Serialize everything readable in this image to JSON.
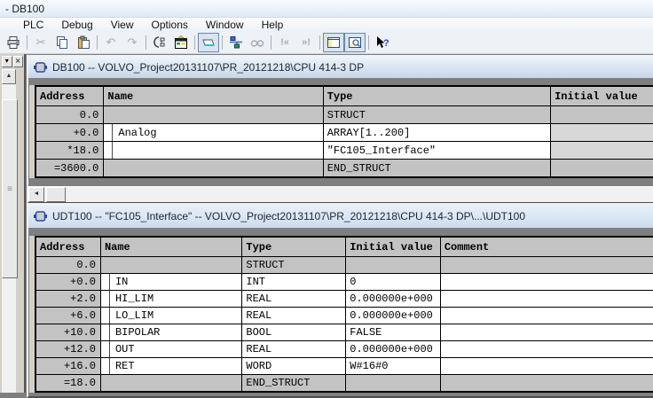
{
  "window": {
    "title": "- DB100"
  },
  "menu": {
    "items": [
      "PLC",
      "Debug",
      "View",
      "Options",
      "Window",
      "Help"
    ]
  },
  "toolbar": {
    "buttons": [
      "print",
      "cut",
      "copy",
      "paste",
      "undo",
      "redo",
      "download",
      "monitor-table",
      "symbol-display-toggle",
      "network",
      "glasses",
      "jump-prev",
      "jump-next",
      "window-declaration-view",
      "window-data-view",
      "help-select"
    ],
    "disabled": [
      "cut",
      "undo",
      "redo",
      "glasses",
      "jump-prev",
      "jump-next"
    ],
    "pressed": [
      "symbol-display-toggle",
      "window-declaration-view",
      "window-data-view"
    ],
    "glyphs": {
      "cut": "✂",
      "undo": "↶",
      "redo": "↷",
      "jump_prev": "!«",
      "jump_next": "»!"
    }
  },
  "left_pane": {
    "menu_button": "▾",
    "close_button": "×",
    "scroll_up": "▲",
    "thumb_grip": "≡"
  },
  "db_window": {
    "title": "DB100 -- VOLVO_Project20131107\\PR_20121218\\CPU 414-3 DP",
    "columns": [
      "Address",
      "Name",
      "Type",
      "Initial value"
    ],
    "col_keys": [
      "address",
      "name",
      "type",
      "initial"
    ],
    "rows": [
      {
        "address": "0.0",
        "name": "",
        "type": "STRUCT",
        "initial": "",
        "kind": "struct"
      },
      {
        "address": "+0.0",
        "name": "Analog",
        "type": "ARRAY[1..200]",
        "initial": "",
        "kind": "data"
      },
      {
        "address": "*18.0",
        "name": "",
        "type": "\"FC105_Interface\"",
        "initial": "",
        "kind": "data"
      },
      {
        "address": "=3600.0",
        "name": "",
        "type": "END_STRUCT",
        "initial": "",
        "kind": "struct"
      }
    ],
    "hscroll_left_arrow": "◄"
  },
  "udt_window": {
    "title": "UDT100 -- \"FC105_Interface\" -- VOLVO_Project20131107\\PR_20121218\\CPU 414-3 DP\\...\\UDT100",
    "columns": [
      "Address",
      "Name",
      "Type",
      "Initial value",
      "Comment"
    ],
    "col_keys": [
      "address",
      "name",
      "type",
      "initial",
      "comment"
    ],
    "rows": [
      {
        "address": "0.0",
        "name": "",
        "type": "STRUCT",
        "initial": "",
        "comment": "",
        "kind": "struct"
      },
      {
        "address": "+0.0",
        "name": "IN",
        "type": "INT",
        "initial": "0",
        "comment": "",
        "kind": "data"
      },
      {
        "address": "+2.0",
        "name": "HI_LIM",
        "type": "REAL",
        "initial": "0.000000e+000",
        "comment": "",
        "kind": "data"
      },
      {
        "address": "+6.0",
        "name": "LO_LIM",
        "type": "REAL",
        "initial": "0.000000e+000",
        "comment": "",
        "kind": "data"
      },
      {
        "address": "+10.0",
        "name": "BIPOLAR",
        "type": "BOOL",
        "initial": "FALSE",
        "comment": "",
        "kind": "data"
      },
      {
        "address": "+12.0",
        "name": "OUT",
        "type": "REAL",
        "initial": "0.000000e+000",
        "comment": "",
        "kind": "data"
      },
      {
        "address": "+16.0",
        "name": "RET",
        "type": "WORD",
        "initial": "W#16#0",
        "comment": "",
        "kind": "data"
      },
      {
        "address": "=18.0",
        "name": "",
        "type": "END_STRUCT",
        "initial": "",
        "comment": "",
        "kind": "struct"
      }
    ]
  },
  "colors": {
    "table_silver": "#c3c3c3",
    "mdi_background": "#7f7f7f",
    "child_titlebar": "#cbdcef",
    "grid_line": "#000000"
  }
}
